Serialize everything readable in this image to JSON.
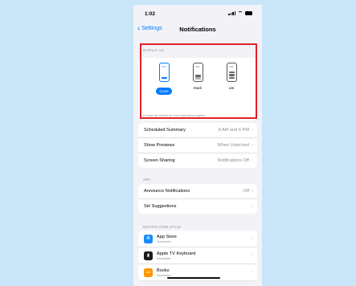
{
  "status": {
    "time": "1:02"
  },
  "nav": {
    "back_label": "Settings",
    "title": "Notifications"
  },
  "display_as": {
    "header": "DISPLAY AS",
    "options": [
      {
        "label": "Count",
        "selected": true,
        "preview_time": "9:41"
      },
      {
        "label": "Stack",
        "selected": false,
        "preview_time": "9:41"
      },
      {
        "label": "List",
        "selected": false,
        "preview_time": "9:41"
      }
    ],
    "footnote": "Choose the default for how notifications appear."
  },
  "settings_rows": [
    {
      "label": "Scheduled Summary",
      "value": "8 AM and 6 PM"
    },
    {
      "label": "Show Previews",
      "value": "When Unlocked"
    },
    {
      "label": "Screen Sharing",
      "value": "Notifications Off"
    }
  ],
  "siri": {
    "header": "SIRI",
    "rows": [
      {
        "label": "Announce Notifications",
        "value": "Off"
      },
      {
        "label": "Siri Suggestions",
        "value": ""
      }
    ]
  },
  "notification_style": {
    "header": "NOTIFICATION STYLE",
    "apps": [
      {
        "name": "App Store",
        "subtitle": "Scheduled",
        "icon": "app-store-icon",
        "color": "#1a8cff",
        "glyph": "A"
      },
      {
        "name": "Apple TV Keyboard",
        "subtitle": "Immediate",
        "icon": "tv-keyboard-icon",
        "color": "#1c1c1e",
        "glyph": "▮"
      },
      {
        "name": "Books",
        "subtitle": "Scheduled",
        "icon": "books-icon",
        "color": "#ff9500",
        "glyph": "▭"
      }
    ]
  },
  "colors": {
    "accent": "#007aff",
    "highlight_border": "#e12125",
    "background": "#c9e6f9"
  }
}
